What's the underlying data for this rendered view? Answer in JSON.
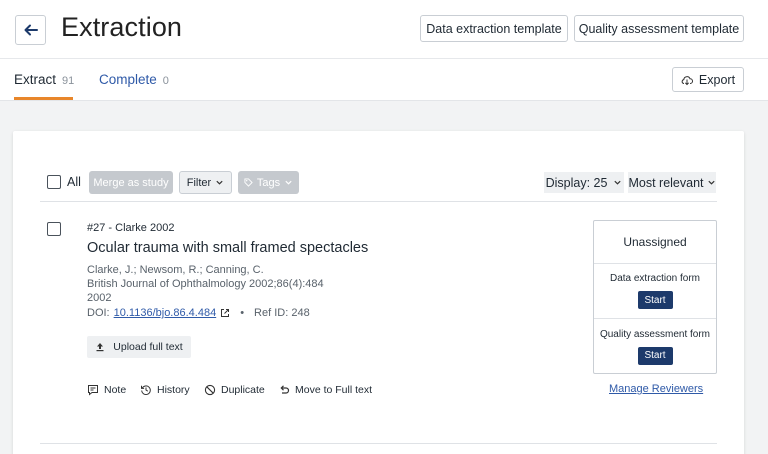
{
  "header": {
    "title": "Extraction",
    "back_icon": "arrow-left-icon",
    "data_template_label": "Data extraction template",
    "quality_template_label": "Quality assessment template"
  },
  "tabs": [
    {
      "label": "Extract",
      "count": "91",
      "active": true
    },
    {
      "label": "Complete",
      "count": "0",
      "active": false
    }
  ],
  "export": {
    "label": "Export",
    "icon": "cloud-download-icon"
  },
  "toolbar": {
    "all_label": "All",
    "merge_label": "Merge as study",
    "filter_label": "Filter",
    "tags_label": "Tags",
    "display_label": "Display: 25",
    "sort_label": "Most relevant"
  },
  "reference": {
    "header": "#27 - Clarke 2002",
    "title": "Ocular trauma with small framed spectacles",
    "authors": "Clarke, J.; Newsom, R.; Canning, C.",
    "journal": "British Journal of Ophthalmology 2002;86(4):484",
    "year": "2002",
    "doi_prefix": "DOI:",
    "doi": "10.1136/bjo.86.4.484",
    "separator": "•",
    "ref_id": "Ref ID: 248",
    "upload_label": "Upload full text",
    "actions": {
      "note": "Note",
      "history": "History",
      "duplicate": "Duplicate",
      "move": "Move to Full text"
    },
    "assignment": {
      "status": "Unassigned",
      "data_form": "Data extraction form",
      "quality_form": "Quality assessment form",
      "start_label": "Start"
    },
    "manage_reviewers": "Manage Reviewers"
  },
  "colors": {
    "accent_tab": "#e8862a",
    "link": "#2f5aa8",
    "start_button": "#1d3a6b"
  }
}
